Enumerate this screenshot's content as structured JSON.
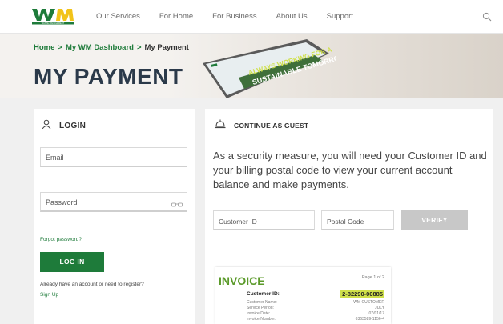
{
  "header": {
    "logo_text": "WASTE MANAGEMENT",
    "nav": [
      "Our Services",
      "For Home",
      "For Business",
      "About Us",
      "Support"
    ]
  },
  "hero": {
    "breadcrumb": [
      "Home",
      "My WM Dashboard",
      "My Payment"
    ],
    "separator": ">",
    "title": "MY PAYMENT",
    "laptop_text_1": "ALWAYS WORKING FOR A",
    "laptop_text_2": "SUSTAINABLE TOMORROW"
  },
  "login": {
    "title": "LOGIN",
    "email_placeholder": "Email",
    "password_placeholder": "Password",
    "forgot": "Forgot password?",
    "button": "LOG IN",
    "register_prompt": "Already have an account or need to register?",
    "signup": "Sign Up"
  },
  "guest": {
    "title": "CONTINUE AS GUEST",
    "message": "As a security measure, you will need your Customer ID and your billing postal code to view your current account balance and make payments.",
    "customer_id_placeholder": "Customer ID",
    "postal_code_placeholder": "Postal Code",
    "verify": "VERIFY"
  },
  "invoice": {
    "title": "INVOICE",
    "page": "Page 1 of 2",
    "customer_id_label": "Customer ID:",
    "customer_id_value": "2-82290-00885",
    "rows": [
      {
        "label": "Customer Name:",
        "value": "WM CUSTOMER"
      },
      {
        "label": "Service Period:",
        "value": "JULY"
      },
      {
        "label": "Invoice Date:",
        "value": "07/01/17"
      },
      {
        "label": "Invoice Number:",
        "value": "6363589-1156-4"
      }
    ]
  },
  "colors": {
    "brand_green": "#1e7b3a",
    "brand_yellow": "#f2c318",
    "invoice_green": "#5b9a2a",
    "highlight": "#cfe04a",
    "title_navy": "#2b3a4a"
  },
  "icons": [
    "search-icon",
    "user-icon",
    "concierge-bell-icon",
    "eye-icon"
  ]
}
